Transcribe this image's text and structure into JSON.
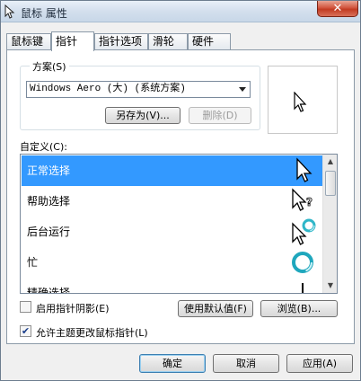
{
  "window": {
    "title": "鼠标 属性",
    "close_label": "✕"
  },
  "tabs": [
    {
      "label": "鼠标键"
    },
    {
      "label": "指针"
    },
    {
      "label": "指针选项"
    },
    {
      "label": "滑轮"
    },
    {
      "label": "硬件"
    }
  ],
  "scheme": {
    "label": "方案(S)",
    "selected": "Windows Aero (大) (系统方案)",
    "save_as_label": "另存为(V)...",
    "delete_label": "删除(D)"
  },
  "customize": {
    "label": "自定义(C):",
    "items": [
      {
        "label": "正常选择",
        "icon": "arrow-cursor-icon"
      },
      {
        "label": "帮助选择",
        "icon": "help-cursor-icon"
      },
      {
        "label": "后台运行",
        "icon": "working-cursor-icon"
      },
      {
        "label": "忙",
        "icon": "busy-cursor-icon"
      },
      {
        "label": "精确选择",
        "icon": "precision-cursor-icon"
      }
    ]
  },
  "options": {
    "shadow_label": "启用指针阴影(E)",
    "shadow_checked": false,
    "use_default_label": "使用默认值(F)",
    "browse_label": "浏览(B)...",
    "allow_theme_label": "允许主题更改鼠标指针(L)",
    "allow_theme_checked": true
  },
  "footer": {
    "ok_label": "确定",
    "cancel_label": "取消",
    "apply_label": "应用(A)"
  }
}
